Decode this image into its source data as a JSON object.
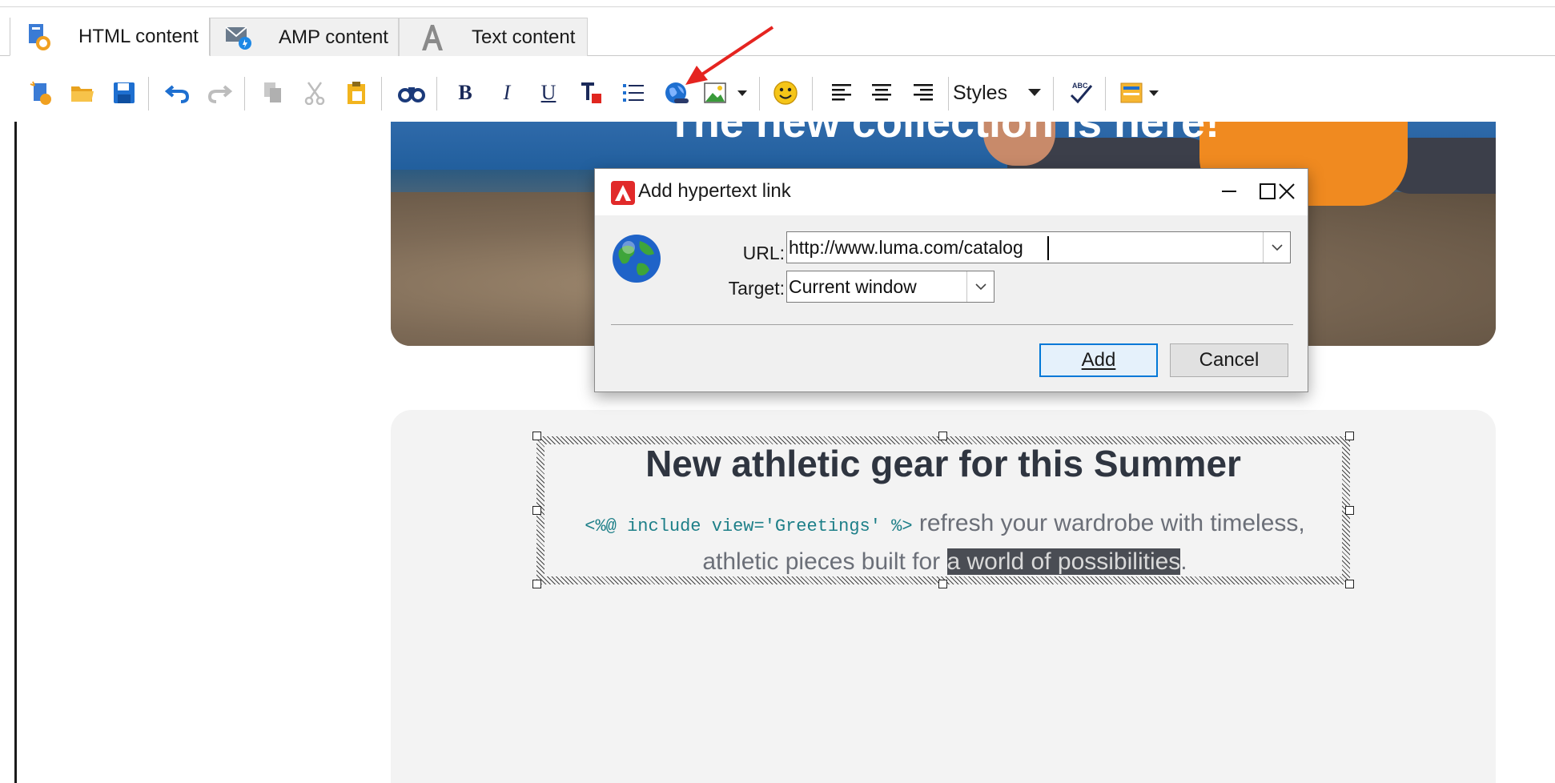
{
  "tabs": [
    {
      "label": "HTML content",
      "icon": "html-content-icon",
      "active": true
    },
    {
      "label": "AMP content",
      "icon": "amp-content-icon",
      "active": false
    },
    {
      "label": "Text content",
      "icon": "text-content-icon",
      "active": false
    }
  ],
  "toolbar": {
    "bold_label": "B",
    "italic_label": "I",
    "underline_label": "U",
    "styles_label": "Styles"
  },
  "hero": {
    "title": "The new collection is here!"
  },
  "content": {
    "heading": "New athletic gear for this Summer",
    "code_snippet": "<%@ include view='Greetings' %>",
    "body_part1": " refresh your wardrobe with timeless, athletic pieces built for ",
    "highlight": "a world of possibilities",
    "body_part2": "."
  },
  "dialog": {
    "title": "Add hypertext link",
    "url_label": "URL:",
    "url_value": "http://www.luma.com/catalog",
    "target_label": "Target:",
    "target_value": "Current window",
    "add_label": "Add",
    "cancel_label": "Cancel"
  },
  "colors": {
    "accent_blue": "#0078d7",
    "annotation_red": "#e52420",
    "adobe_red": "#e12a2a",
    "highlight_bg": "#4a4d54"
  }
}
